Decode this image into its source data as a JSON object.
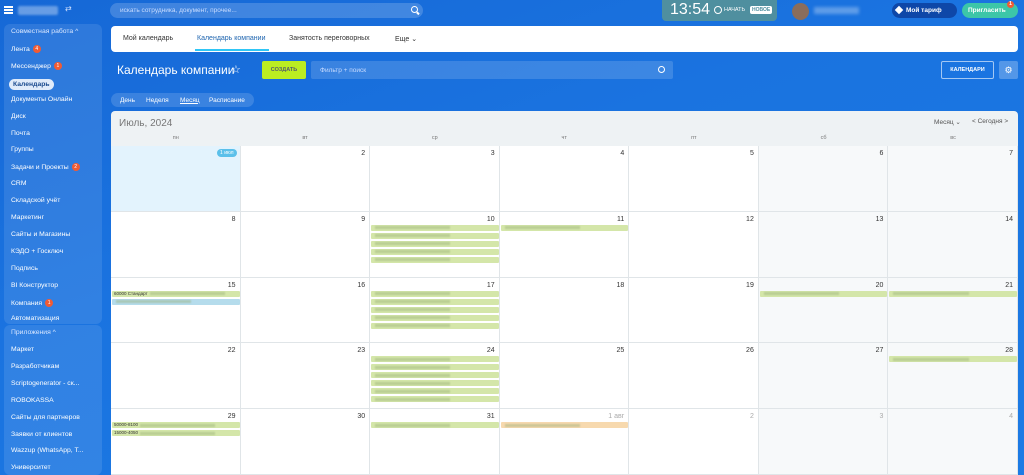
{
  "topbar": {
    "search_placeholder": "искать сотрудника, документ, прочее...",
    "clock_time": "13:54",
    "start_label": "НАЧАТЬ",
    "new_badge": "НОВОЕ",
    "tariff_label": "Мой тариф",
    "invite_label": "Пригласить",
    "invite_count": "1",
    "swap_icon": "⇄"
  },
  "sidebar": {
    "group1_header": "Совместная работа ^",
    "items1": [
      {
        "label": "Лента",
        "count": "4"
      },
      {
        "label": "Мессенджер",
        "count": "1"
      },
      {
        "label": "Календарь",
        "active": true
      },
      {
        "label": "Документы Онлайн"
      },
      {
        "label": "Диск"
      },
      {
        "label": "Почта"
      },
      {
        "label": "Группы"
      },
      {
        "label": "Задачи и Проекты",
        "count": "2"
      },
      {
        "label": "CRM"
      },
      {
        "label": "Складской учёт"
      },
      {
        "label": "Маркетинг"
      },
      {
        "label": "Сайты и Магазины"
      },
      {
        "label": "КЭДО + Госключ"
      },
      {
        "label": "Подпись"
      },
      {
        "label": "BI Конструктор"
      },
      {
        "label": "Компания",
        "count": "1"
      },
      {
        "label": "Автоматизация"
      }
    ],
    "group2_header": "Приложения ^",
    "items2": [
      {
        "label": "Маркет"
      },
      {
        "label": "Разработчикам"
      },
      {
        "label": "Scriptogenerator - ск..."
      },
      {
        "label": "ROBOKASSA"
      },
      {
        "label": "Сайты для партнеров"
      },
      {
        "label": "Заявки от клиентов"
      },
      {
        "label": "Wazzup (WhatsApp, T..."
      },
      {
        "label": "Университет"
      }
    ]
  },
  "header": {
    "tabs": [
      {
        "label": "Мой календарь"
      },
      {
        "label": "Календарь компании",
        "active": true
      },
      {
        "label": "Занятость переговорных"
      },
      {
        "label": "Еще ⌄"
      }
    ]
  },
  "toolbar": {
    "title": "Календарь компании",
    "star": "☆",
    "create_label": "СОЗДАТЬ",
    "filter_placeholder": "Фильтр + поиск",
    "calendars_label": "КАЛЕНДАРИ",
    "gear": "⚙"
  },
  "views": [
    {
      "label": "День"
    },
    {
      "label": "Неделя"
    },
    {
      "label": "Месяц",
      "selected": true
    },
    {
      "label": "Расписание"
    }
  ],
  "calendar": {
    "month_title": "Июль, 2024",
    "mode_select": "Месяц ⌄",
    "today_nav": "<  Сегодня  >",
    "weekdays": [
      "пн",
      "вт",
      "ср",
      "чт",
      "пт",
      "сб",
      "вс"
    ],
    "weeks": [
      [
        "1 июл",
        "2",
        "3",
        "4",
        "5",
        "6",
        "7"
      ],
      [
        "8",
        "9",
        "10",
        "11",
        "12",
        "13",
        "14"
      ],
      [
        "15",
        "16",
        "17",
        "18",
        "19",
        "20",
        "21"
      ],
      [
        "22",
        "23",
        "24",
        "25",
        "26",
        "27",
        "28"
      ],
      [
        "29",
        "30",
        "31",
        "1 авг",
        "2",
        "3",
        "4"
      ]
    ],
    "event_texts": {
      "w3_mon_1": "60000 Стандарт",
      "w3_mon_2": "",
      "w5_mon_1": "50000-8100",
      "w5_mon_2": "15000-4050"
    }
  }
}
